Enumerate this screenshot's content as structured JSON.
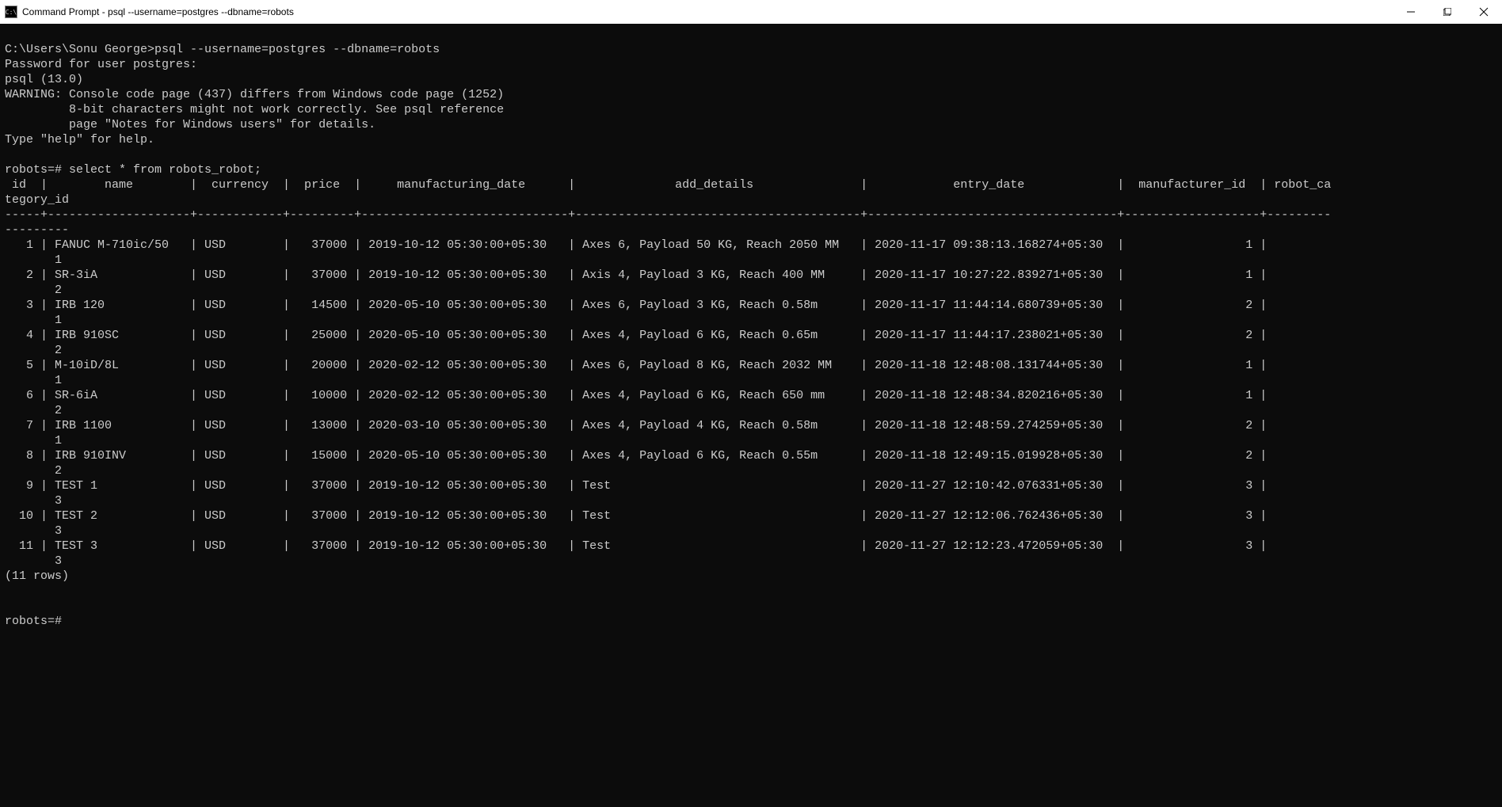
{
  "titlebar": {
    "icon_text": "C:\\",
    "title": "Command Prompt - psql  --username=postgres --dbname=robots"
  },
  "prompt_path": "C:\\Users\\Sonu George>",
  "command": "psql --username=postgres --dbname=robots",
  "password_line": "Password for user postgres:",
  "psql_version": "psql (13.0)",
  "warning_line1": "WARNING: Console code page (437) differs from Windows code page (1252)",
  "warning_line2": "         8-bit characters might not work correctly. See psql reference",
  "warning_line3": "         page \"Notes for Windows users\" for details.",
  "help_line": "Type \"help\" for help.",
  "db_prompt": "robots=#",
  "query": "select * from robots_robot;",
  "columns": [
    "id",
    "name",
    "currency",
    "price",
    "manufacturing_date",
    "add_details",
    "entry_date",
    "manufacturer_id",
    "robot_category_id"
  ],
  "header_wrap_col": "tegory_id",
  "rows": [
    {
      "id": "1",
      "name": "FANUC M-710ic/50",
      "currency": "USD",
      "price": "37000",
      "mfg": "2019-10-12 05:30:00+05:30",
      "details": "Axes 6, Payload 50 KG, Reach 2050 MM",
      "entry": "2020-11-17 09:38:13.168274+05:30",
      "mid": "1",
      "cat": "1"
    },
    {
      "id": "2",
      "name": "SR-3iA",
      "currency": "USD",
      "price": "37000",
      "mfg": "2019-10-12 05:30:00+05:30",
      "details": "Axis 4, Payload 3 KG, Reach 400 MM",
      "entry": "2020-11-17 10:27:22.839271+05:30",
      "mid": "1",
      "cat": "2"
    },
    {
      "id": "3",
      "name": "IRB 120",
      "currency": "USD",
      "price": "14500",
      "mfg": "2020-05-10 05:30:00+05:30",
      "details": "Axes 6, Payload 3 KG, Reach 0.58m",
      "entry": "2020-11-17 11:44:14.680739+05:30",
      "mid": "2",
      "cat": "1"
    },
    {
      "id": "4",
      "name": "IRB 910SC",
      "currency": "USD",
      "price": "25000",
      "mfg": "2020-05-10 05:30:00+05:30",
      "details": "Axes 4, Payload 6 KG, Reach 0.65m",
      "entry": "2020-11-17 11:44:17.238021+05:30",
      "mid": "2",
      "cat": "2"
    },
    {
      "id": "5",
      "name": "M-10iD/8L",
      "currency": "USD",
      "price": "20000",
      "mfg": "2020-02-12 05:30:00+05:30",
      "details": "Axes 6, Payload 8 KG, Reach 2032 MM",
      "entry": "2020-11-18 12:48:08.131744+05:30",
      "mid": "1",
      "cat": "1"
    },
    {
      "id": "6",
      "name": "SR-6iA",
      "currency": "USD",
      "price": "10000",
      "mfg": "2020-02-12 05:30:00+05:30",
      "details": "Axes 4, Payload 6 KG, Reach 650 mm",
      "entry": "2020-11-18 12:48:34.820216+05:30",
      "mid": "1",
      "cat": "2"
    },
    {
      "id": "7",
      "name": "IRB 1100",
      "currency": "USD",
      "price": "13000",
      "mfg": "2020-03-10 05:30:00+05:30",
      "details": "Axes 4, Payload 4 KG, Reach 0.58m",
      "entry": "2020-11-18 12:48:59.274259+05:30",
      "mid": "2",
      "cat": "1"
    },
    {
      "id": "8",
      "name": "IRB 910INV",
      "currency": "USD",
      "price": "15000",
      "mfg": "2020-05-10 05:30:00+05:30",
      "details": "Axes 4, Payload 6 KG, Reach 0.55m",
      "entry": "2020-11-18 12:49:15.019928+05:30",
      "mid": "2",
      "cat": "2"
    },
    {
      "id": "9",
      "name": "TEST 1",
      "currency": "USD",
      "price": "37000",
      "mfg": "2019-10-12 05:30:00+05:30",
      "details": "Test",
      "entry": "2020-11-27 12:10:42.076331+05:30",
      "mid": "3",
      "cat": "3"
    },
    {
      "id": "10",
      "name": "TEST 2",
      "currency": "USD",
      "price": "37000",
      "mfg": "2019-10-12 05:30:00+05:30",
      "details": "Test",
      "entry": "2020-11-27 12:12:06.762436+05:30",
      "mid": "3",
      "cat": "3"
    },
    {
      "id": "11",
      "name": "TEST 3",
      "currency": "USD",
      "price": "37000",
      "mfg": "2019-10-12 05:30:00+05:30",
      "details": "Test",
      "entry": "2020-11-27 12:12:23.472059+05:30",
      "mid": "3",
      "cat": "3"
    }
  ],
  "row_count_line": "(11 rows)",
  "final_prompt": "robots=#",
  "col_widths": {
    "id": 4,
    "name": 18,
    "currency": 10,
    "price": 7,
    "mfg": 27,
    "details": 38,
    "entry": 33,
    "mid": 17
  },
  "wrap_cat_pad": 8
}
